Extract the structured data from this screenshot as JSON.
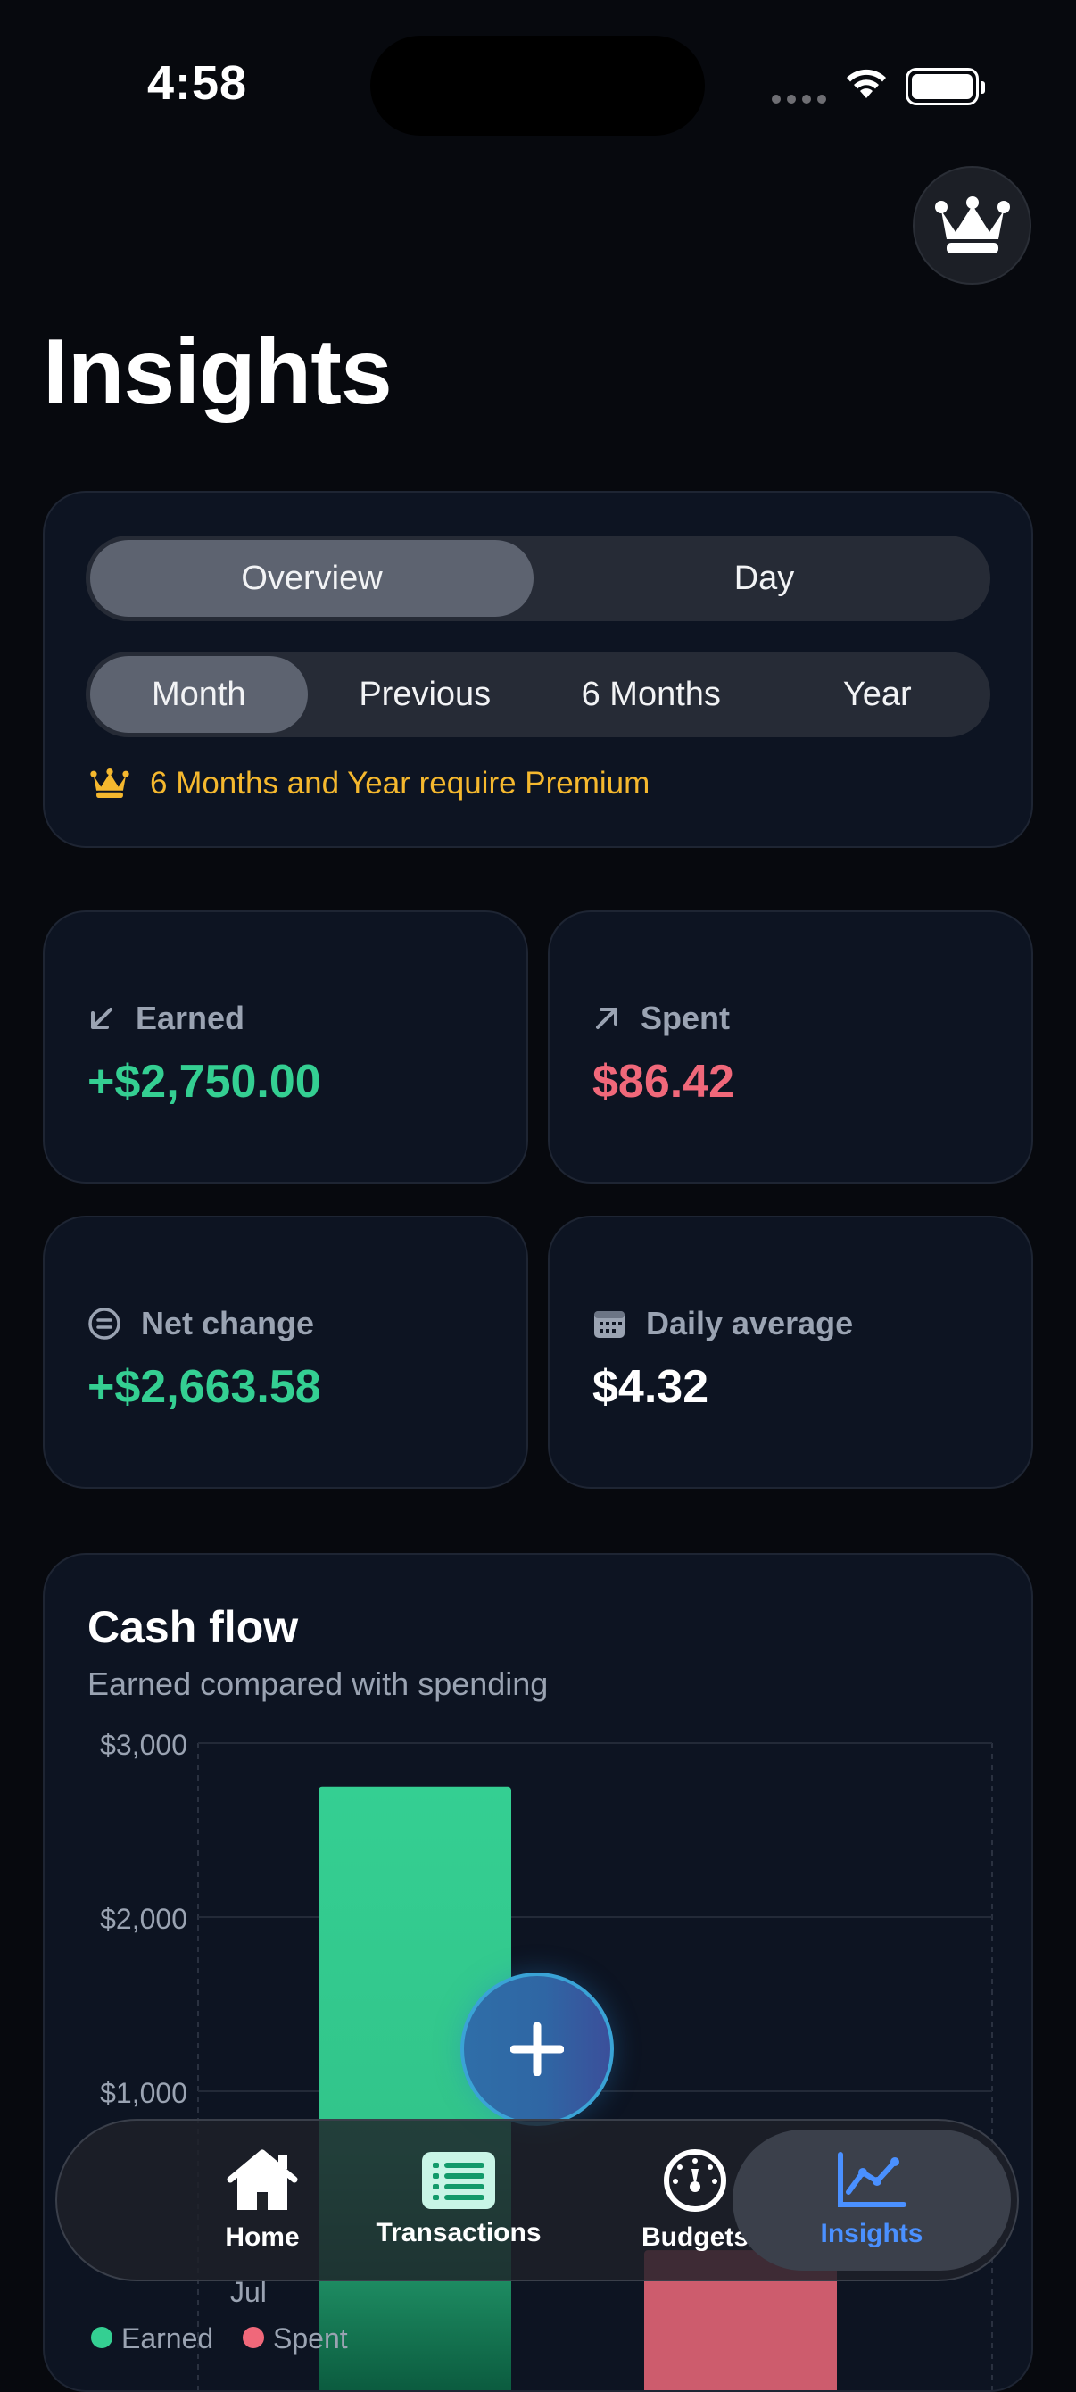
{
  "status_bar": {
    "time": "4:58"
  },
  "page": {
    "title": "Insights"
  },
  "segments": {
    "view": [
      "Overview",
      "Day"
    ],
    "view_selected": "Overview",
    "range": [
      "Month",
      "Previous",
      "6 Months",
      "Year"
    ],
    "range_selected": "Month",
    "premium_note": "6 Months and Year require Premium"
  },
  "stats": {
    "earned": {
      "label": "Earned",
      "value": "+$2,750.00"
    },
    "spent": {
      "label": "Spent",
      "value": "$86.42"
    },
    "net": {
      "label": "Net change",
      "value": "+$2,663.58"
    },
    "daily": {
      "label": "Daily average",
      "value": "$4.32"
    }
  },
  "cash_flow": {
    "title": "Cash flow",
    "subtitle": "Earned compared with spending"
  },
  "chart_data": {
    "type": "bar",
    "title": "Cash flow",
    "subtitle": "Earned compared with spending",
    "categories": [
      "Jul"
    ],
    "series": [
      {
        "name": "Earned",
        "values": [
          2750.0
        ],
        "color": "#34cf92"
      },
      {
        "name": "Spent",
        "values": [
          86.42
        ],
        "color": "#f0687a"
      }
    ],
    "yticks": [
      "$3,000",
      "$2,000",
      "$1,000"
    ],
    "ylim": [
      0,
      3000
    ],
    "grid": true,
    "legend": "bottom-left"
  },
  "colors": {
    "accent": "#4a90ff",
    "earned": "#34cf92",
    "spent": "#f0687a",
    "premium": "#f5b82e",
    "background": "#07090e",
    "card": "#0d1422"
  },
  "tabbar": {
    "items": [
      {
        "label": "Home",
        "icon": "house-icon"
      },
      {
        "label": "Transactions",
        "icon": "list-icon"
      },
      {
        "label": "Budgets",
        "icon": "gauge-icon"
      },
      {
        "label": "Insights",
        "icon": "chart-line-icon"
      }
    ],
    "selected": "Insights"
  },
  "fab": {
    "icon": "plus-icon"
  }
}
